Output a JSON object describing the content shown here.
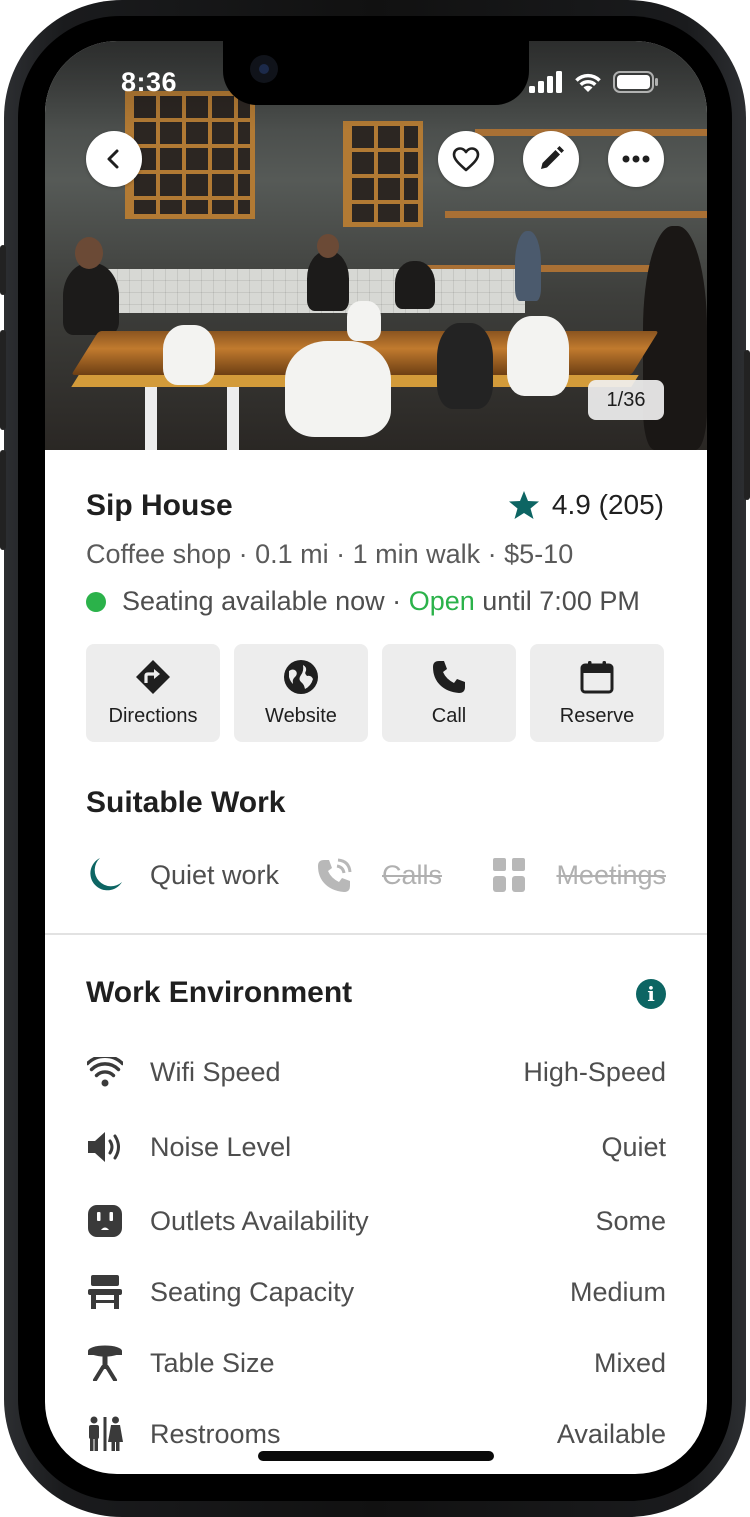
{
  "status_bar": {
    "time": "8:36"
  },
  "hero": {
    "photo_counter": "1/36"
  },
  "place": {
    "name": "Sip House",
    "rating": "4.9 (205)",
    "meta": "Coffee shop · 0.1 mi · 1 min walk · $5-10",
    "seating": "Seating available now · ",
    "open_word": "Open",
    "hours": " until 7:00 PM"
  },
  "actions": [
    {
      "label": "Directions",
      "icon": "directions-icon"
    },
    {
      "label": "Website",
      "icon": "globe-icon"
    },
    {
      "label": "Call",
      "icon": "phone-icon"
    },
    {
      "label": "Reserve",
      "icon": "calendar-icon"
    }
  ],
  "suitable_work": {
    "heading": "Suitable Work",
    "items": [
      {
        "label": "Quiet work",
        "available": true
      },
      {
        "label": "Calls",
        "available": false
      },
      {
        "label": "Meetings",
        "available": false
      }
    ]
  },
  "environment": {
    "heading": "Work Environment",
    "rows": [
      {
        "label": "Wifi Speed",
        "value": "High-Speed",
        "icon": "wifi-icon"
      },
      {
        "label": "Noise Level",
        "value": "Quiet",
        "icon": "speaker-icon"
      },
      {
        "label": "Outlets Availability",
        "value": "Some",
        "icon": "outlet-icon"
      },
      {
        "label": "Seating Capacity",
        "value": "Medium",
        "icon": "bench-icon"
      },
      {
        "label": "Table Size",
        "value": "Mixed",
        "icon": "table-icon"
      },
      {
        "label": "Restrooms",
        "value": "Available",
        "icon": "restroom-icon"
      }
    ]
  },
  "colors": {
    "accent": "#0d6563",
    "open_green": "#2bb24a"
  }
}
